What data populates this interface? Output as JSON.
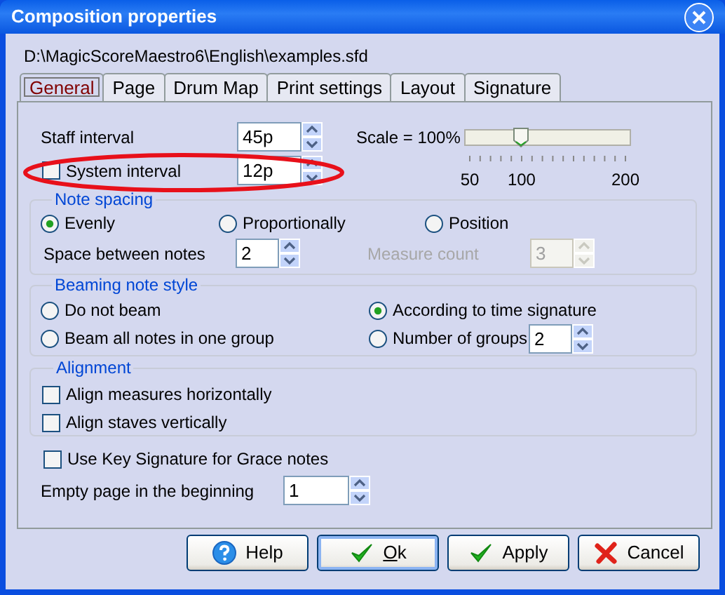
{
  "window": {
    "title": "Composition properties"
  },
  "file_path": "D:\\MagicScoreMaestro6\\English\\examples.sfd",
  "tabs": [
    {
      "label": "General",
      "selected": true
    },
    {
      "label": "Page",
      "selected": false
    },
    {
      "label": "Drum Map",
      "selected": false
    },
    {
      "label": "Print settings",
      "selected": false
    },
    {
      "label": "Layout",
      "selected": false
    },
    {
      "label": "Signature",
      "selected": false
    }
  ],
  "staff_interval": {
    "label": "Staff interval",
    "value": "45p"
  },
  "scale": {
    "label": "Scale = 100%",
    "level": 0.33,
    "tick_labels": [
      "50",
      "100",
      "200"
    ]
  },
  "system_interval": {
    "label": "System interval",
    "checked": false,
    "value": "12p",
    "circled": true
  },
  "note_spacing": {
    "legend": "Note spacing",
    "options": [
      {
        "label": "Evenly",
        "selected": true
      },
      {
        "label": "Proportionally",
        "selected": false
      },
      {
        "label": "Position",
        "selected": false
      }
    ],
    "space_between_notes": {
      "label": "Space between notes",
      "value": "2"
    },
    "measure_count": {
      "label": "Measure count",
      "value": "3",
      "disabled": true
    }
  },
  "beaming": {
    "legend": "Beaming note style",
    "options": [
      {
        "label": "Do not beam",
        "selected": false
      },
      {
        "label": "According to time signature",
        "selected": true
      },
      {
        "label": "Beam all notes in one group",
        "selected": false
      },
      {
        "label": "Number of groups",
        "selected": false,
        "value": "2"
      }
    ]
  },
  "alignment": {
    "legend": "Alignment",
    "options": [
      {
        "label": "Align measures horizontally",
        "checked": false
      },
      {
        "label": "Align staves vertically",
        "checked": false
      }
    ]
  },
  "grace_notes": {
    "label": "Use Key Signature for Grace notes",
    "checked": false
  },
  "empty_page": {
    "label": "Empty page in the beginning",
    "value": "1"
  },
  "buttons": [
    {
      "label": "Help",
      "kind": "help",
      "focused": false,
      "underline_first": false
    },
    {
      "label": "Ok",
      "kind": "confirm",
      "focused": true,
      "underline_first": true
    },
    {
      "label": "Apply",
      "kind": "confirm",
      "focused": false,
      "underline_first": false
    },
    {
      "label": "Cancel",
      "kind": "cancel",
      "focused": false,
      "underline_first": false
    }
  ]
}
